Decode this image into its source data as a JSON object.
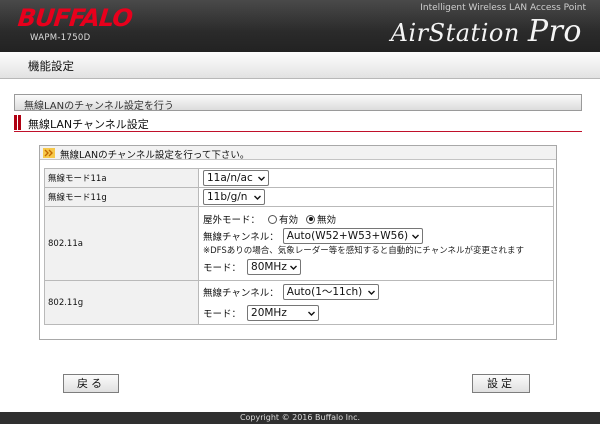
{
  "header": {
    "brand": "BUFFALO",
    "model": "WAPM-1750D",
    "tagline": "Intelligent Wireless LAN Access Point",
    "product_main": "AirStation ",
    "product_pro": "Pro"
  },
  "page_title": "機能設定",
  "section_title": "無線LANのチャンネル設定を行う",
  "sub_title": "無線LANチャンネル設定",
  "box": {
    "heading": "無線LANのチャンネル設定を行って下さい。",
    "rows": {
      "mode11a": {
        "label": "無線モード11a",
        "value": "11a/n/ac"
      },
      "mode11g": {
        "label": "無線モード11g",
        "value": "11b/g/n"
      },
      "band11a": {
        "label": "802.11a",
        "outdoor_label": "屋外モード：",
        "outdoor_on": "有効",
        "outdoor_off": "無効",
        "outdoor_selected": "無効",
        "channel_label": "無線チャンネル：",
        "channel_value": "Auto(W52+W53+W56)",
        "dfs_note": "※DFSありの場合、気象レーダー等を感知すると自動的にチャンネルが変更されます",
        "mode_label": "モード：",
        "mode_value": "80MHz"
      },
      "band11g": {
        "label": "802.11g",
        "channel_label": "無線チャンネル：",
        "channel_value": "Auto(1～11ch)",
        "mode_label": "モード：",
        "mode_value": "20MHz"
      }
    }
  },
  "buttons": {
    "back": "戻る",
    "apply": "設定"
  },
  "footer": "Copyright © 2016 Buffalo Inc.",
  "colors": {
    "accent_red": "#c0102a",
    "brand_red": "#e8001c",
    "header_bg": "#2b2b2b"
  }
}
